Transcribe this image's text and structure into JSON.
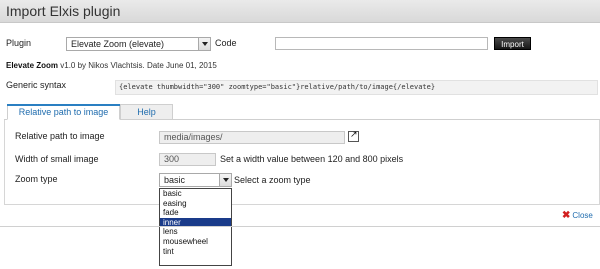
{
  "window": {
    "title": "Import Elxis plugin"
  },
  "plugin_row": {
    "plugin_label": "Plugin",
    "plugin_value": "Elevate Zoom (elevate)",
    "code_label": "Code",
    "code_value": "",
    "import_label": "Import"
  },
  "meta": {
    "name": "Elevate Zoom",
    "rest": " v1.0 by Nikos Vlachtsis. Date June 01, 2015"
  },
  "syntax": {
    "label": "Generic syntax",
    "code": "{elevate thumbwidth=\"300\" zoomtype=\"basic\"}relative/path/to/image{/elevate}"
  },
  "tabs": [
    {
      "label": "Relative path to image"
    },
    {
      "label": "Help"
    }
  ],
  "form": {
    "path_label": "Relative path to image",
    "path_value": "media/images/",
    "width_label": "Width of small image",
    "width_value": "300",
    "width_help": "Set a width value between 120 and 800 pixels",
    "zoom_label": "Zoom type",
    "zoom_value": "basic",
    "zoom_help": "Select a zoom type"
  },
  "zoom_options": [
    "basic",
    "easing",
    "fade",
    "inner",
    "lens",
    "mousewheel",
    "tint"
  ],
  "zoom_highlighted": "inner",
  "close_label": "Close",
  "colors": {
    "accent": "#1f6cae",
    "selected": "#1a3b8a",
    "close_icon": "#d21f1f"
  }
}
